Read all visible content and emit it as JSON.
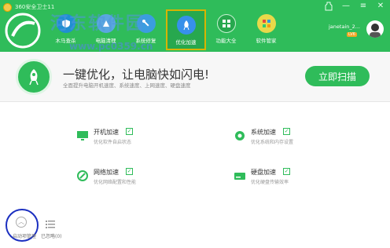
{
  "window": {
    "title": "360安全卫士11",
    "controls": [
      "wardrobe-icon",
      "minimize-icon",
      "menu-icon",
      "close-icon"
    ]
  },
  "watermark": {
    "text": "河东软件园",
    "url": "www.pc0359.cn"
  },
  "nav": {
    "items": [
      {
        "label": "木马查杀",
        "icon": "shield-scan-icon",
        "active": false
      },
      {
        "label": "电脑清理",
        "icon": "broom-icon",
        "active": false
      },
      {
        "label": "系统修复",
        "icon": "wrench-icon",
        "active": false
      },
      {
        "label": "优化加速",
        "icon": "rocket-icon",
        "active": true
      },
      {
        "label": "功能大全",
        "icon": "grid-icon",
        "active": false
      },
      {
        "label": "软件管家",
        "icon": "apps-icon",
        "active": false
      }
    ]
  },
  "user": {
    "name": "janetain_2...",
    "badge": "LV6"
  },
  "banner": {
    "headline": "一键优化，让电脑快如闪电!",
    "sub": "全面提升电脑开机速度、系统速度、上网速度、硬盘速度",
    "button": "立即扫描"
  },
  "features": [
    {
      "name": "开机加速",
      "desc": "优化软件自启状态",
      "icon": "monitor-icon",
      "checked": true
    },
    {
      "name": "系统加速",
      "desc": "优化系统和内存设置",
      "icon": "gear-icon",
      "checked": true
    },
    {
      "name": "网络加速",
      "desc": "优化网络配置和性能",
      "icon": "network-icon",
      "checked": true
    },
    {
      "name": "硬盘加速",
      "desc": "优化硬盘传输效率",
      "icon": "harddisk-icon",
      "checked": true
    }
  ],
  "bottom": {
    "left_label": "启动项管理",
    "ignored_label": "已忽略(0)"
  },
  "colors": {
    "brand_green": "#2fbc5a",
    "highlight_yellow": "#d6b400",
    "annotation_blue": "#1b2fc0"
  }
}
